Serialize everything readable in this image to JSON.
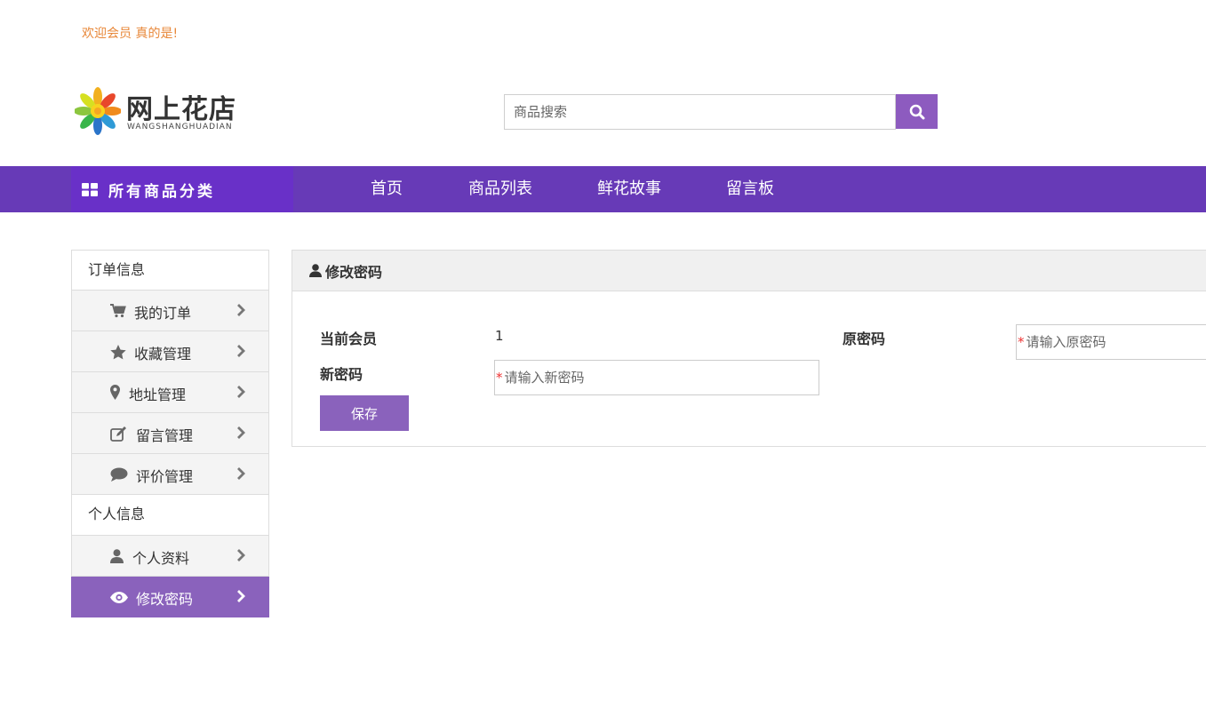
{
  "header": {
    "welcome_text": "欢迎会员 真的是!",
    "logo_title": "网上花店",
    "logo_subtitle": "WANGSHANGHUADIAN",
    "search_placeholder": "商品搜索"
  },
  "colors": {
    "brand_purple": "#673ab7",
    "button_purple": "#8a62bc",
    "welcome_orange": "#e8883a"
  },
  "nav": {
    "category_label": "所有商品分类",
    "items": [
      {
        "label": "首页"
      },
      {
        "label": "商品列表"
      },
      {
        "label": "鲜花故事"
      },
      {
        "label": "留言板"
      }
    ]
  },
  "sidebar": {
    "order_section_title": "订单信息",
    "order_items": [
      {
        "label": "我的订单",
        "icon": "cart-icon"
      },
      {
        "label": "收藏管理",
        "icon": "star-icon"
      },
      {
        "label": "地址管理",
        "icon": "map-marker-icon"
      },
      {
        "label": "留言管理",
        "icon": "edit-icon"
      },
      {
        "label": "评价管理",
        "icon": "comment-icon"
      }
    ],
    "personal_section_title": "个人信息",
    "personal_items": [
      {
        "label": "个人资料",
        "icon": "user-icon"
      },
      {
        "label": "修改密码",
        "icon": "eye-icon",
        "active": true
      }
    ]
  },
  "panel": {
    "title": "修改密码",
    "current_member_label": "当前会员",
    "current_member_value": "1",
    "old_password_label": "原密码",
    "old_password_placeholder": "请输入原密码",
    "new_password_label": "新密码",
    "new_password_placeholder": "请输入新密码",
    "required_mark": "*",
    "save_label": "保存"
  }
}
